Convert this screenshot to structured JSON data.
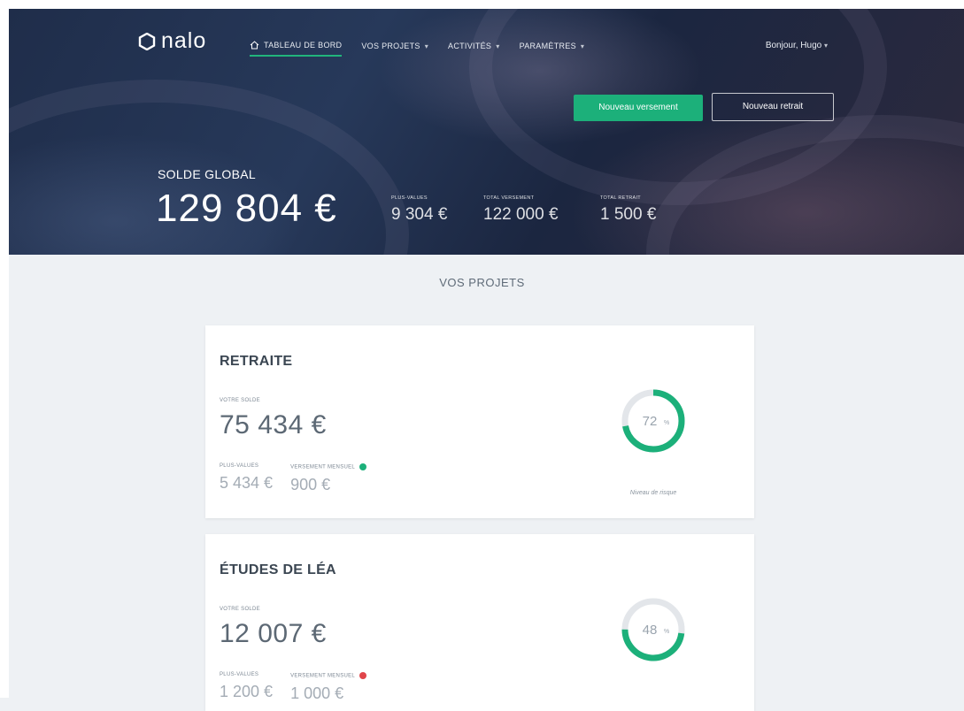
{
  "brand": {
    "name": "nalo",
    "accent": "#1cb07a"
  },
  "nav": {
    "items": [
      {
        "label": "TABLEAU DE BORD",
        "icon": "home-icon",
        "active": true
      },
      {
        "label": "VOS PROJETS",
        "caret": true
      },
      {
        "label": "ACTIVITÉS",
        "caret": true
      },
      {
        "label": "PARAMÈTRES",
        "caret": true
      }
    ],
    "greeting": "Bonjour, Hugo"
  },
  "actions": {
    "new_deposit": "Nouveau versement",
    "new_withdrawal": "Nouveau retrait"
  },
  "summary": {
    "label": "SOLDE GLOBAL",
    "value": "129 804 €",
    "stats": [
      {
        "label": "PLUS-VALUES",
        "value": "9 304 €"
      },
      {
        "label": "TOTAL VERSEMENT",
        "value": "122 000 €"
      },
      {
        "label": "TOTAL RETRAIT",
        "value": "1 500 €"
      }
    ]
  },
  "projects": {
    "title": "VOS PROJETS",
    "items": [
      {
        "name": "RETRAITE",
        "balance_label": "VOTRE SOLDE",
        "balance": "75 434 €",
        "gains_label": "PLUS-VALUES",
        "gains": "5 434 €",
        "monthly_label": "VERSEMENT MENSUEL",
        "monthly": "900 €",
        "monthly_status_color": "#1cb07a",
        "risk_percent": 72,
        "risk_text": "72",
        "risk_caption": "Niveau de risque"
      },
      {
        "name": "ÉTUDES DE LÉA",
        "balance_label": "VOTRE SOLDE",
        "balance": "12 007 €",
        "gains_label": "PLUS-VALUES",
        "gains": "1 200 €",
        "monthly_label": "VERSEMENT MENSUEL",
        "monthly": "1 000 €",
        "monthly_status_color": "#e0454a",
        "risk_percent": 48,
        "risk_text": "48"
      }
    ]
  }
}
